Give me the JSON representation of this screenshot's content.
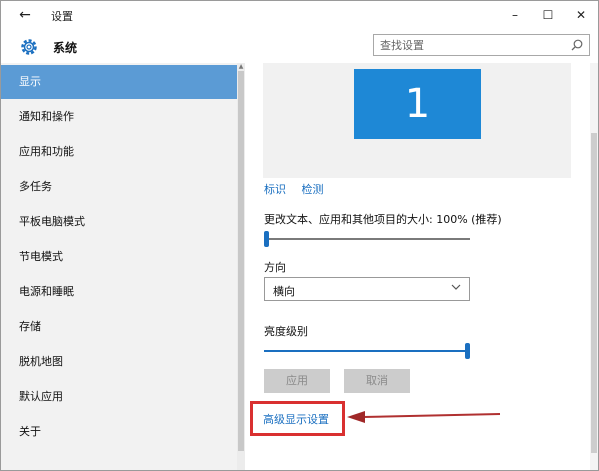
{
  "window": {
    "title": "设置",
    "back_icon": "←",
    "minimize": "–",
    "maximize": "☐",
    "close": "✕"
  },
  "header": {
    "section_title": "系统",
    "search_placeholder": "查找设置"
  },
  "sidebar": {
    "items": [
      {
        "label": "显示",
        "active": true
      },
      {
        "label": "通知和操作",
        "active": false
      },
      {
        "label": "应用和功能",
        "active": false
      },
      {
        "label": "多任务",
        "active": false
      },
      {
        "label": "平板电脑模式",
        "active": false
      },
      {
        "label": "节电模式",
        "active": false
      },
      {
        "label": "电源和睡眠",
        "active": false
      },
      {
        "label": "存储",
        "active": false
      },
      {
        "label": "脱机地图",
        "active": false
      },
      {
        "label": "默认应用",
        "active": false
      },
      {
        "label": "关于",
        "active": false
      }
    ]
  },
  "display": {
    "monitor_number": "1",
    "identify_link": "标识",
    "detect_link": "检测",
    "scale_label": "更改文本、应用和其他项目的大小: 100% (推荐)",
    "scale_level": 0.0,
    "orientation_label": "方向",
    "orientation_value": "横向",
    "brightness_label": "亮度级别",
    "brightness_level": 1.0,
    "apply_button": "应用",
    "cancel_button": "取消",
    "advanced_link": "高级显示设置"
  },
  "colors": {
    "accent": "#1a6fc0",
    "monitor": "#1e88d6",
    "sidebar_active": "#5b9bd5",
    "highlight": "#d93030"
  }
}
